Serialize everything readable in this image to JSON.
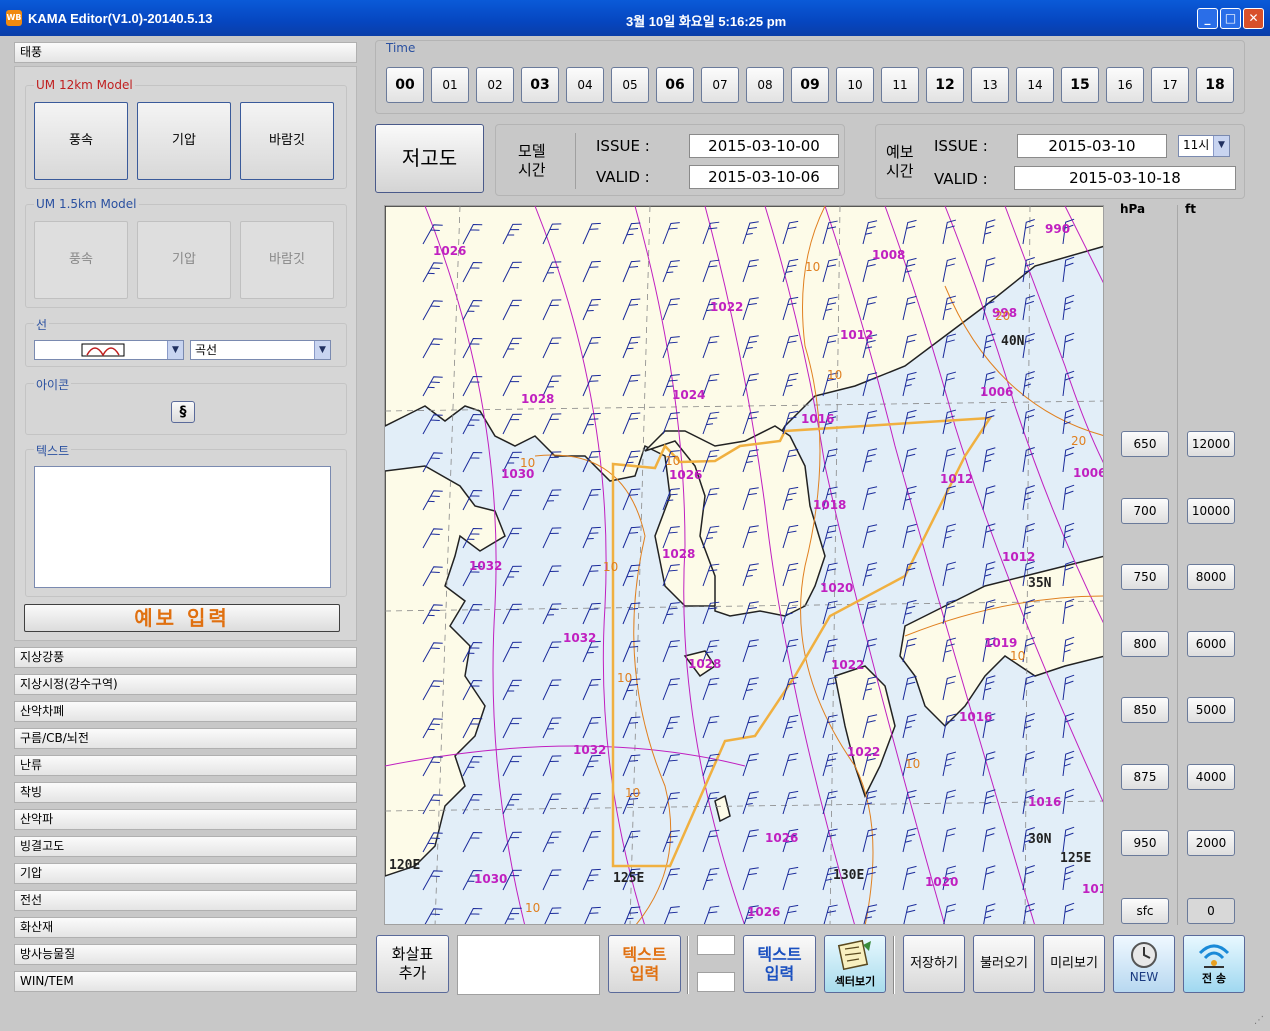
{
  "window": {
    "title": "KAMA Editor(V1.0)-20140.5.13",
    "datetime": "3월 10일  화요일  5:16:25 pm",
    "logo": "WB",
    "minimize": "_",
    "maximize": "□",
    "close": "✕"
  },
  "sidebar": {
    "typhoon_header": "태풍",
    "um12": {
      "label": "UM 12km Model",
      "buttons": [
        "풍속",
        "기압",
        "바람깃"
      ]
    },
    "um15": {
      "label": "UM 1.5km Model",
      "buttons": [
        "풍속",
        "기압",
        "바람깃"
      ]
    },
    "line": {
      "label": "선",
      "style_value": "",
      "type_value": "곡선"
    },
    "icon": {
      "label": "아이콘",
      "symbol": "§"
    },
    "text": {
      "label": "텍스트"
    },
    "forecast_input": "예보 입력",
    "categories": [
      "지상강풍",
      "지상시정(강수구역)",
      "산악차폐",
      "구름/CB/뇌전",
      "난류",
      "착빙",
      "산악파",
      "빙결고도",
      "기압",
      "전선",
      "화산재",
      "방사능물질",
      "WIN/TEM"
    ]
  },
  "time": {
    "label": "Time",
    "hours": [
      "00",
      "01",
      "02",
      "03",
      "04",
      "05",
      "06",
      "07",
      "08",
      "09",
      "10",
      "11",
      "12",
      "13",
      "14",
      "15",
      "16",
      "17",
      "18"
    ]
  },
  "altitude_button": "저고도",
  "model_time": {
    "label_line1": "모델",
    "label_line2": "시간",
    "issue_label": "ISSUE :",
    "valid_label": "VALID :",
    "issue_value": "2015-03-10-00",
    "valid_value": "2015-03-10-06"
  },
  "forecast_time": {
    "label_line1": "예보",
    "label_line2": "시간",
    "issue_label": "ISSUE :",
    "valid_label": "VALID :",
    "issue_value": "2015-03-10",
    "hour_value": "11시",
    "valid_value": "2015-03-10-18"
  },
  "map": {
    "isobar_labels": [
      "1026",
      "1008",
      "990",
      "1022",
      "1012",
      "998",
      "1028",
      "1024",
      "1016",
      "1006",
      "1030",
      "1026",
      "1012",
      "1006",
      "1018",
      "1028",
      "1032",
      "1012",
      "1020",
      "1032",
      "1028",
      "1022",
      "1019",
      "1016",
      "1032",
      "1022",
      "1016",
      "1026",
      "1030",
      "1020",
      "1026",
      "101"
    ],
    "temp_labels": [
      "10",
      "20",
      "10",
      "10",
      "10",
      "10",
      "10",
      "10",
      "20",
      "10",
      "10",
      "10"
    ],
    "grid_labels": [
      "40N",
      "35N",
      "30N",
      "125E",
      "120E",
      "125E",
      "130E"
    ],
    "colors": {
      "sea": "#e2eef8",
      "land": "#fdfbe8",
      "isobar": "#c020c0",
      "isotherm": "#e08020",
      "barb": "#1a2a9a",
      "fir": "#f0b040"
    }
  },
  "levels": {
    "hpa_label": "hPa",
    "ft_label": "ft",
    "hpa": [
      "650",
      "700",
      "750",
      "800",
      "850",
      "875",
      "950",
      "sfc"
    ],
    "ft": [
      "12000",
      "10000",
      "8000",
      "6000",
      "5000",
      "4000",
      "2000",
      "0"
    ]
  },
  "toolbar": {
    "arrow_add_1": "화살표",
    "arrow_add_2": "추가",
    "text_input_1a": "텍스트",
    "text_input_1b": "입력",
    "text_input_2a": "텍스트",
    "text_input_2b": "입력",
    "sector_view": "섹터보기",
    "save": "저장하기",
    "load": "불러오기",
    "preview": "미리보기",
    "new": "NEW",
    "send": "전 송"
  }
}
